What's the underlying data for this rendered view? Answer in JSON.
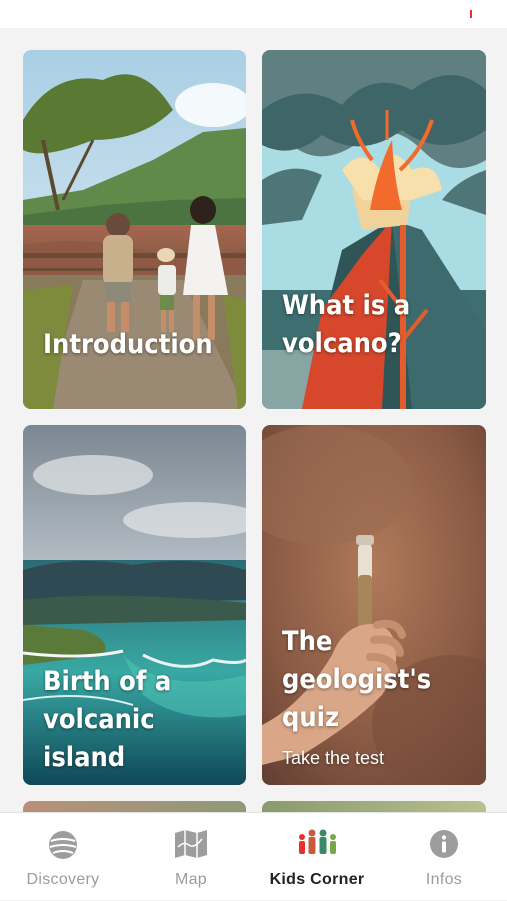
{
  "cards": [
    {
      "id": "introduction",
      "lines": [
        "Introduction"
      ],
      "subtitle": ""
    },
    {
      "id": "what-is-a-volcano",
      "lines": [
        "What is a",
        "volcano?"
      ],
      "subtitle": ""
    },
    {
      "id": "birth-of-a-volcanic-island",
      "lines": [
        "Birth of a",
        "volcanic island"
      ],
      "subtitle": ""
    },
    {
      "id": "geologists-quiz",
      "lines": [
        "The",
        "geologist's",
        "quiz"
      ],
      "subtitle": "Take the test"
    }
  ],
  "tabbar": {
    "active": "kids-corner",
    "tabs": [
      {
        "id": "discovery",
        "label": "Discovery",
        "icon": "planet-icon"
      },
      {
        "id": "map",
        "label": "Map",
        "icon": "map-icon"
      },
      {
        "id": "kids-corner",
        "label": "Kids Corner",
        "icon": "family-icon"
      },
      {
        "id": "infos",
        "label": "Infos",
        "icon": "info-icon"
      }
    ]
  },
  "colors": {
    "accent": "#e5322d",
    "active_tab_text": "#222222",
    "inactive_tab_text": "#9c9c9c",
    "icon_gray": "#9d9d9d"
  }
}
